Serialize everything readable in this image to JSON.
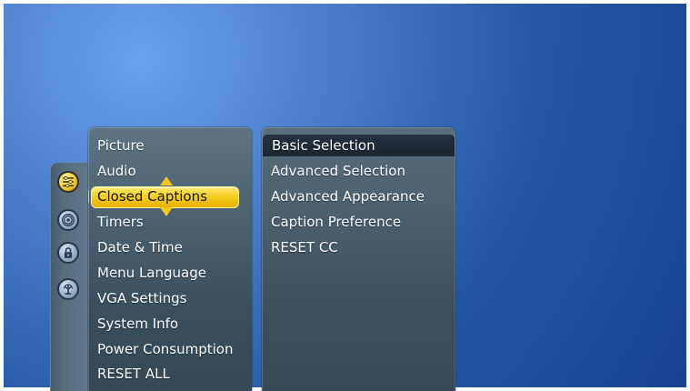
{
  "colors": {
    "background_blue": "#2f6ec3",
    "panel_gray": "#4b6170",
    "selected_yellow": "#f7cf21",
    "highlight_dark": "#1f2a34",
    "text_white": "#ffffff"
  },
  "sidebar_icons": [
    {
      "name": "settings-icon"
    },
    {
      "name": "broadcast-icon"
    },
    {
      "name": "lock-icon"
    },
    {
      "name": "antenna-icon"
    }
  ],
  "menu": {
    "items": [
      {
        "label": "Picture"
      },
      {
        "label": "Audio"
      },
      {
        "label": "Closed Captions"
      },
      {
        "label": "Timers"
      },
      {
        "label": "Date & Time"
      },
      {
        "label": "Menu Language"
      },
      {
        "label": "VGA Settings"
      },
      {
        "label": "System Info"
      },
      {
        "label": "Power Consumption"
      },
      {
        "label": "RESET ALL"
      }
    ]
  },
  "submenu": {
    "items": [
      {
        "label": "Basic Selection"
      },
      {
        "label": "Advanced Selection"
      },
      {
        "label": "Advanced Appearance"
      },
      {
        "label": "Caption Preference"
      },
      {
        "label": "RESET CC"
      }
    ]
  }
}
